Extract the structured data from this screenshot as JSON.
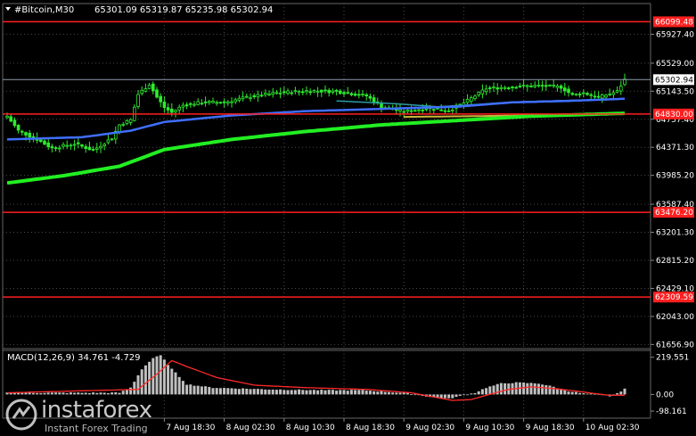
{
  "header": {
    "symbol_timeframe": "#Bitcoin,M30",
    "ohlc": "65301.09 65319.87 65235.98 65302.94"
  },
  "macd_label": "MACD(12,26,9) 34.761 -4.729",
  "watermark": {
    "name": "instaforex",
    "tagline": "Instant Forex Trading"
  },
  "colors": {
    "background": "#000000",
    "grid": "#4a4a4a",
    "candles": "#2eea2e",
    "level_lines": "#ff1f1f",
    "ma_fast": "#3f6fff",
    "ma_teal": "#2a9ba6",
    "ma_slow": "#22ee22",
    "ma_olive": "#c7b83a",
    "macd_hist": "#c0c0c0",
    "macd_signal": "#ff2a2a"
  },
  "chart_data": [
    {
      "type": "candlestick",
      "symbol": "#Bitcoin",
      "timeframe": "M30",
      "ylim": [
        61600,
        66350
      ],
      "y_ticks": [
        "65927.40",
        "65529.00",
        "65143.50",
        "64757.40",
        "64371.30",
        "63985.20",
        "63587.40",
        "63201.30",
        "62815.20",
        "62429.10",
        "62043.00",
        "61656.90"
      ],
      "y_tick_values": [
        65927.4,
        65529.0,
        65143.5,
        64757.4,
        64371.3,
        63985.2,
        63587.4,
        63201.3,
        62815.2,
        62429.1,
        62043.0,
        61656.9
      ],
      "x_ticks": [
        "7 Aug 18:30",
        "8 Aug 02:30",
        "8 Aug 10:30",
        "8 Aug 18:30",
        "9 Aug 02:30",
        "9 Aug 10:30",
        "9 Aug 18:30",
        "10 Aug 02:30"
      ],
      "x_tick_index": [
        42,
        58,
        74,
        90,
        106,
        122,
        138,
        154
      ],
      "price_levels": [
        {
          "value": 66099.48,
          "label": "66099.48"
        },
        {
          "value": 64830.0,
          "label": "64830.00"
        },
        {
          "value": 63476.2,
          "label": "63476.20"
        },
        {
          "value": 62309.59,
          "label": "62309.59"
        }
      ],
      "current_price": {
        "value": 65302.94,
        "label": "65302.94"
      },
      "anchors": {
        "close": [
          [
            0,
            64800
          ],
          [
            3,
            64600
          ],
          [
            8,
            64480
          ],
          [
            12,
            64360
          ],
          [
            18,
            64420
          ],
          [
            23,
            64330
          ],
          [
            28,
            64500
          ],
          [
            30,
            64680
          ],
          [
            33,
            64750
          ],
          [
            35,
            65100
          ],
          [
            38,
            65240
          ],
          [
            40,
            65060
          ],
          [
            42,
            64920
          ],
          [
            44,
            64850
          ],
          [
            47,
            64950
          ],
          [
            52,
            64990
          ],
          [
            58,
            64990
          ],
          [
            64,
            65060
          ],
          [
            72,
            65120
          ],
          [
            80,
            65150
          ],
          [
            88,
            65140
          ],
          [
            96,
            65080
          ],
          [
            100,
            64930
          ],
          [
            106,
            64860
          ],
          [
            112,
            64910
          ],
          [
            118,
            64880
          ],
          [
            122,
            64980
          ],
          [
            128,
            65180
          ],
          [
            136,
            65210
          ],
          [
            142,
            65220
          ],
          [
            148,
            65200
          ],
          [
            151,
            65090
          ],
          [
            154,
            65120
          ],
          [
            158,
            65060
          ],
          [
            163,
            65140
          ],
          [
            165,
            65302.94
          ]
        ],
        "ma_blue": [
          [
            0,
            64480
          ],
          [
            20,
            64510
          ],
          [
            33,
            64600
          ],
          [
            42,
            64720
          ],
          [
            60,
            64810
          ],
          [
            80,
            64870
          ],
          [
            100,
            64900
          ],
          [
            120,
            64930
          ],
          [
            135,
            64990
          ],
          [
            150,
            65010
          ],
          [
            165,
            65040
          ]
        ],
        "ma_teal": [
          [
            88,
            65010
          ],
          [
            104,
            64970
          ],
          [
            115,
            64930
          ],
          [
            125,
            64960
          ],
          [
            135,
            64995
          ],
          [
            145,
            65010
          ],
          [
            165,
            65040
          ]
        ],
        "ma_slow": [
          [
            0,
            63880
          ],
          [
            15,
            63980
          ],
          [
            30,
            64110
          ],
          [
            42,
            64340
          ],
          [
            60,
            64480
          ],
          [
            80,
            64590
          ],
          [
            100,
            64680
          ],
          [
            120,
            64740
          ],
          [
            140,
            64800
          ],
          [
            165,
            64840
          ]
        ],
        "ma_olive": [
          [
            106,
            64790
          ],
          [
            125,
            64800
          ],
          [
            145,
            64815
          ],
          [
            165,
            64845
          ]
        ]
      }
    },
    {
      "type": "bar",
      "name": "MACD(12,26,9)",
      "main_value": 34.761,
      "signal_value": -4.729,
      "ylim": [
        -140,
        260
      ],
      "y_ticks": [
        "219.551",
        "0.00",
        "-98.161"
      ],
      "y_tick_values": [
        219.551,
        0.0,
        -98.161
      ],
      "hist_anchors": [
        [
          0,
          10
        ],
        [
          30,
          10
        ],
        [
          33,
          40
        ],
        [
          36,
          150
        ],
        [
          39,
          215
        ],
        [
          41,
          230
        ],
        [
          44,
          150
        ],
        [
          48,
          60
        ],
        [
          55,
          40
        ],
        [
          70,
          30
        ],
        [
          85,
          25
        ],
        [
          95,
          25
        ],
        [
          102,
          15
        ],
        [
          108,
          5
        ],
        [
          113,
          -15
        ],
        [
          118,
          -25
        ],
        [
          122,
          -5
        ],
        [
          125,
          10
        ],
        [
          128,
          40
        ],
        [
          132,
          65
        ],
        [
          136,
          70
        ],
        [
          142,
          65
        ],
        [
          146,
          45
        ],
        [
          150,
          20
        ],
        [
          154,
          5
        ],
        [
          158,
          0
        ],
        [
          161,
          -10
        ],
        [
          163,
          5
        ],
        [
          165,
          34.761
        ]
      ],
      "signal_anchors": [
        [
          0,
          10
        ],
        [
          35,
          30
        ],
        [
          40,
          120
        ],
        [
          44,
          200
        ],
        [
          48,
          165
        ],
        [
          56,
          100
        ],
        [
          66,
          55
        ],
        [
          80,
          40
        ],
        [
          96,
          30
        ],
        [
          108,
          10
        ],
        [
          114,
          -15
        ],
        [
          119,
          -35
        ],
        [
          124,
          -30
        ],
        [
          128,
          -5
        ],
        [
          134,
          30
        ],
        [
          140,
          45
        ],
        [
          146,
          35
        ],
        [
          152,
          20
        ],
        [
          157,
          5
        ],
        [
          161,
          -5
        ],
        [
          165,
          -4.729
        ]
      ]
    }
  ]
}
